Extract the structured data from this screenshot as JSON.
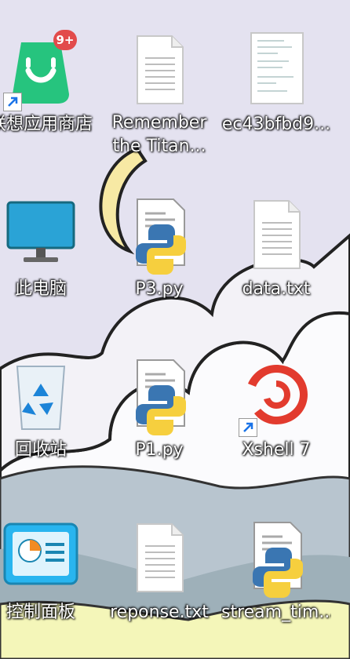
{
  "desktop": {
    "icons": [
      {
        "label": "联想应用商店",
        "shortcut": true,
        "badge": "9+"
      },
      {
        "label_line1": "Remember",
        "label_line2": "the Titan..."
      },
      {
        "label": "ec43bfbd9..."
      },
      {
        "label": "此电脑"
      },
      {
        "label": "P3.py"
      },
      {
        "label": "data.txt"
      },
      {
        "label": "回收站"
      },
      {
        "label": "P1.py"
      },
      {
        "label": "Xshell 7",
        "shortcut": true
      },
      {
        "label": "控制面板"
      },
      {
        "label": "reponse.txt"
      },
      {
        "label": "stream_tim..."
      }
    ]
  }
}
